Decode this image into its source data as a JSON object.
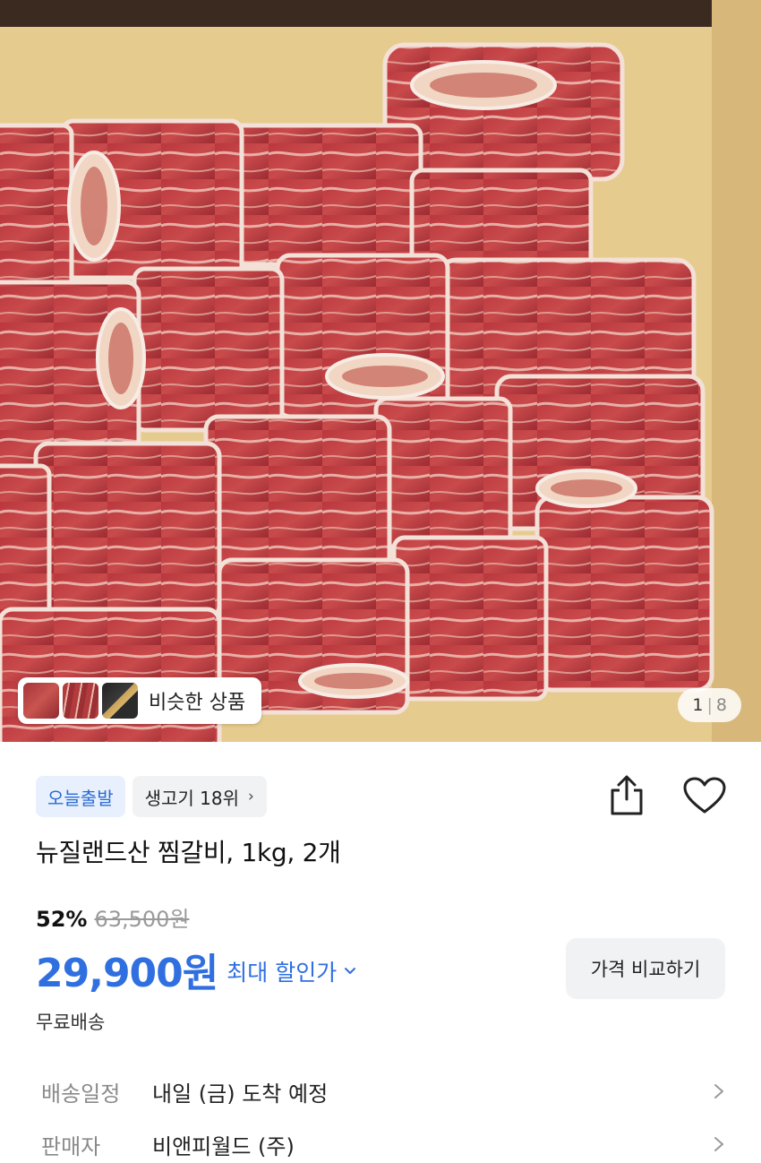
{
  "gallery": {
    "similar_label": "비슷한 상품",
    "counter_current": "1",
    "counter_total": "8"
  },
  "badges": {
    "today_delivery": "오늘출발",
    "rank": "생고기 18위"
  },
  "product": {
    "title": "뉴질랜드산 찜갈비, 1kg, 2개",
    "discount_rate": "52%",
    "original_price": "63,500원",
    "sale_price": "29,900원",
    "max_discount_label": "최대 할인가",
    "compare_button": "가격 비교하기",
    "shipping_fee": "무료배송"
  },
  "details": [
    {
      "key": "배송일정",
      "value": "내일 (금) 도착 예정"
    },
    {
      "key": "판매자",
      "value": "비앤피월드 (주)"
    }
  ],
  "colors": {
    "accent": "#2f6fe0",
    "badge_bg": "#e8f0fd",
    "chip_bg": "#f1f2f4"
  }
}
